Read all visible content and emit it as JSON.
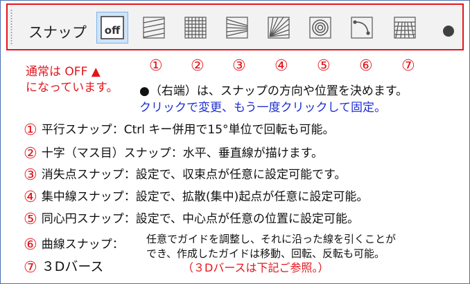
{
  "toolbar": {
    "label": "スナップ",
    "buttons": [
      {
        "name": "snap-off",
        "icon": "off-icon",
        "text": "off",
        "active": true
      },
      {
        "name": "parallel",
        "icon": "parallel-lines-icon"
      },
      {
        "name": "cross",
        "icon": "grid-icon"
      },
      {
        "name": "vanishing",
        "icon": "vanishing-point-icon"
      },
      {
        "name": "radial",
        "icon": "radial-lines-icon"
      },
      {
        "name": "concentric",
        "icon": "concentric-circles-icon"
      },
      {
        "name": "curve",
        "icon": "curve-icon"
      },
      {
        "name": "3d",
        "icon": "3d-perspective-icon"
      }
    ],
    "dot_icon": "dot-menu-icon"
  },
  "notes": {
    "default_line1": "通常は OFF ▲",
    "default_line2": "になっています。",
    "desc_line1": "●（右端）は、スナップの方向や位置を決めます。",
    "desc_line2": "クリックで変更、もう一度クリックして固定。"
  },
  "numbers": [
    "①",
    "②",
    "③",
    "④",
    "⑤",
    "⑥",
    "⑦"
  ],
  "items": [
    {
      "num": "①",
      "text": "平行スナップ：Ctrl キー併用で15°単位で回転も可能。"
    },
    {
      "num": "②",
      "text": "十字（マス目）スナップ：水平、垂直線が描けます。"
    },
    {
      "num": "③",
      "text": "消失点スナップ：設定で、収束点が任意に設定可能です。"
    },
    {
      "num": "④",
      "text": "集中線スナップ：設定で、拡散(集中)起点が任意に設定可能。"
    },
    {
      "num": "⑤",
      "text": "同心円スナップ：設定で、中心点が任意の位置に設定可能。"
    },
    {
      "num": "⑥",
      "text": "曲線スナップ："
    },
    {
      "num": "⑦",
      "text": "３Dバース"
    }
  ],
  "item6_detail": {
    "line1": "任意でガイドを調整し、それに沿った線を引くことが",
    "line2": "でき、作成したガイドは移動、回転、反転も可能。"
  },
  "item7_note": "（３Dバースは下記ご参照。）",
  "colors": {
    "accent_red": "#e3141b",
    "accent_blue": "#1e2fd1",
    "active_button": "#cfe3f7"
  }
}
